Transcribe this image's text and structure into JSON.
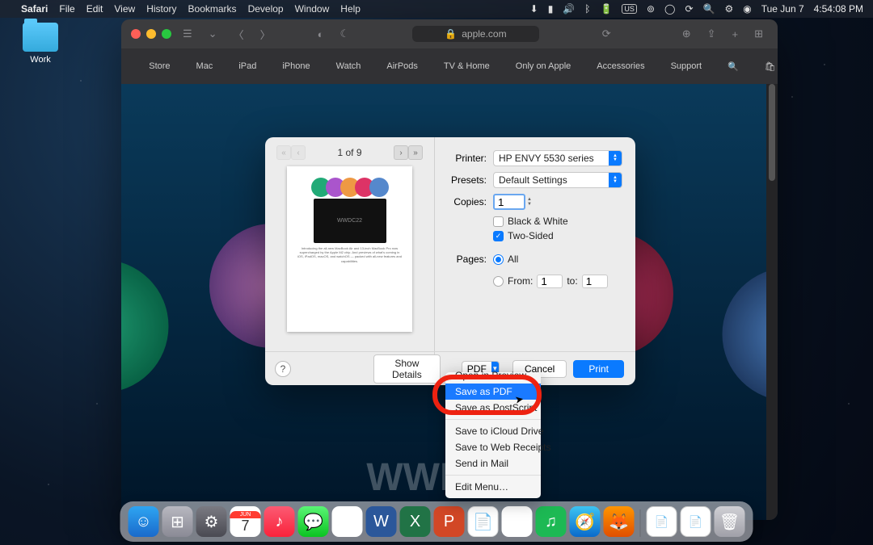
{
  "menubar": {
    "app": "Safari",
    "items": [
      "File",
      "Edit",
      "View",
      "History",
      "Bookmarks",
      "Develop",
      "Window",
      "Help"
    ],
    "date": "Tue Jun 7",
    "time": "4:54:08 PM"
  },
  "desktop": {
    "folder_label": "Work"
  },
  "safari": {
    "url": "apple.com",
    "nav": [
      "Store",
      "Mac",
      "iPad",
      "iPhone",
      "Watch",
      "AirPods",
      "TV & Home",
      "Only on Apple",
      "Accessories",
      "Support"
    ],
    "hero": "WWDC22"
  },
  "print": {
    "page_of": "1 of 9",
    "labels": {
      "printer": "Printer:",
      "presets": "Presets:",
      "copies": "Copies:",
      "pages": "Pages:",
      "bw": "Black & White",
      "twosided": "Two-Sided",
      "all": "All",
      "from": "From:",
      "to": "to:"
    },
    "printer": "HP ENVY 5530 series",
    "presets": "Default Settings",
    "copies": "1",
    "from": "1",
    "to": "1",
    "buttons": {
      "details": "Show Details",
      "pdf": "PDF",
      "cancel": "Cancel",
      "print": "Print",
      "help": "?"
    },
    "thumb_title": "WWDC22"
  },
  "pdf_menu": {
    "open_preview": "Open in Preview",
    "save_pdf": "Save as PDF",
    "save_ps": "Save as PostScript",
    "icloud": "Save to iCloud Drive",
    "webreceipts": "Save to Web Receipts",
    "sendmail": "Send in Mail",
    "editmenu": "Edit Menu…"
  },
  "dock": {
    "cal_mon": "JUN",
    "cal_day": "7"
  }
}
